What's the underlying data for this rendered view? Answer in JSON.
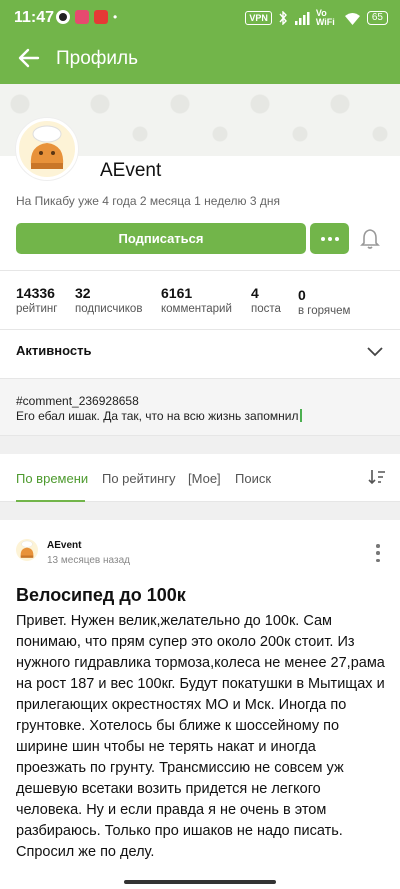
{
  "status_bar": {
    "time": "11:47",
    "vpn": "VPN",
    "network": "Vo WiFi",
    "battery": "65"
  },
  "app_bar": {
    "title": "Профиль"
  },
  "profile": {
    "username": "AEvent",
    "since": "На Пикабу уже 4 года 2 месяца 1 неделю 3 дня",
    "subscribe_label": "Подписаться"
  },
  "stats": [
    {
      "value": "14336",
      "label": "рейтинг"
    },
    {
      "value": "32",
      "label": "подписчиков"
    },
    {
      "value": "6161",
      "label": "комментарий"
    },
    {
      "value": "4",
      "label": "поста"
    },
    {
      "value": "0",
      "label": "в горячем"
    }
  ],
  "activity": {
    "label": "Активность"
  },
  "note": {
    "line1": "#comment_236928658",
    "line2": "Его ебал ишак. Да так, что на всю жизнь запомнил"
  },
  "tabs": [
    {
      "label": "По времени",
      "active": true
    },
    {
      "label": "По рейтингу",
      "active": false
    },
    {
      "label": "[Мое]",
      "active": false
    },
    {
      "label": "Поиск",
      "active": false
    }
  ],
  "post": {
    "author": "AEvent",
    "time": "13 месяцев назад",
    "title": "Велосипед до 100к",
    "body": "Привет. Нужен велик,желательно до 100к. Сам понимаю, что прям супер это около 200к стоит. Из нужного гидравлика тормоза,колеса не менее 27,рама на рост 187 и вес 100кг. Будут покатушки в Мытищах и прилегающих окрестностях МО и Мск. Иногда по грунтовке. Хотелось бы ближе к шоссейному по ширине шин чтобы не терять накат и иногда проезжать по грунту. Трансмиссию не совсем уж дешевую всетаки возить придется не легкого человека. Ну и если правда я не очень в этом разбираюсь. Только про ишаков не надо писать. Спросил же по делу."
  },
  "colors": {
    "brand_green": "#72b54a",
    "active_tab": "#4d9a2e"
  }
}
